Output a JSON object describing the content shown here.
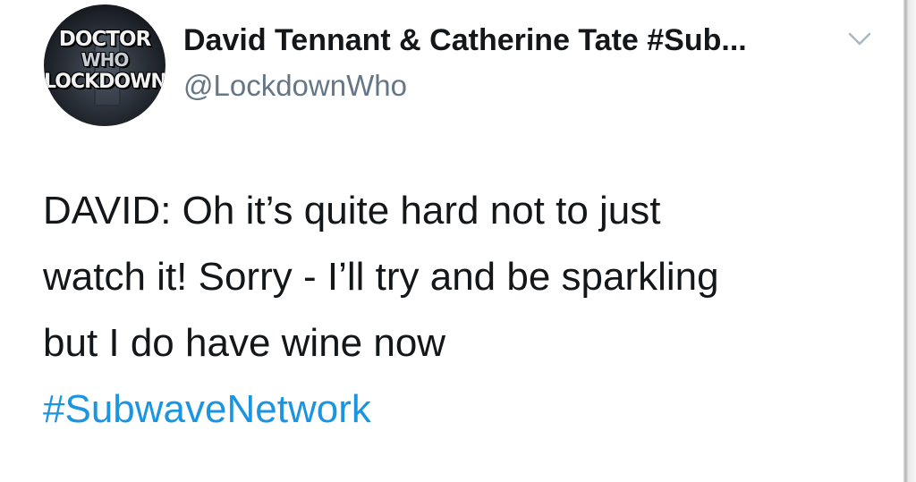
{
  "tweet": {
    "avatar": {
      "logo_lines": [
        "DOCTOR",
        "WHO",
        "LOCKDOWN"
      ]
    },
    "display_name": "David Tennant & Catherine Tate #Sub...",
    "handle": "@LockdownWho",
    "menu_icon": "chevron-down-icon",
    "text_lines": [
      "DAVID: Oh it’s quite hard not to just",
      "watch it! Sorry - I’ll try and be sparkling",
      "but I do have wine now"
    ],
    "hashtag": "#SubwaveNetwork"
  },
  "colors": {
    "text": "#14171a",
    "secondary": "#657786",
    "link": "#1b95e0",
    "background": "#ffffff"
  }
}
